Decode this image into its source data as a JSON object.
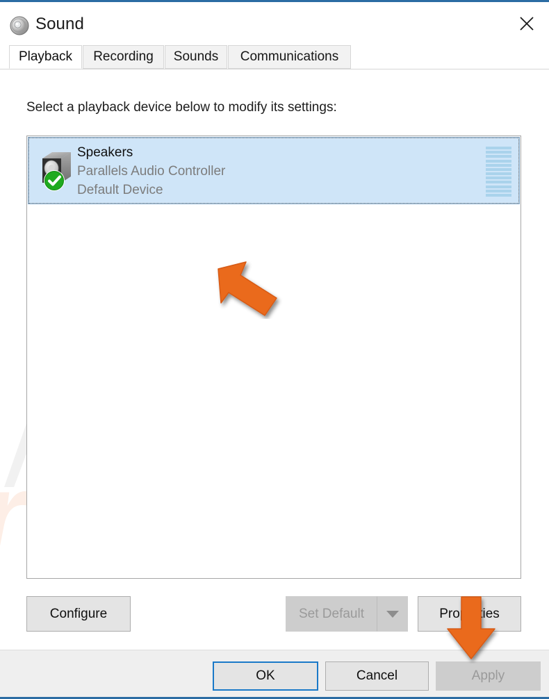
{
  "window": {
    "title": "Sound",
    "icon": "speaker-icon",
    "close_label": "✕",
    "accent_border": "#2b6ca3"
  },
  "tabs": [
    {
      "label": "Playback",
      "active": true
    },
    {
      "label": "Recording",
      "active": false
    },
    {
      "label": "Sounds",
      "active": false
    },
    {
      "label": "Communications",
      "active": false
    }
  ],
  "content": {
    "instruction": "Select a playback device below to modify its settings:"
  },
  "devices": [
    {
      "name": "Speakers",
      "description": "Parallels Audio Controller",
      "status": "Default Device",
      "selected": true,
      "default_badge": "check-circle-icon",
      "meter_segments": 12,
      "meter_active": 0
    }
  ],
  "middle_buttons": [
    {
      "id": "configure",
      "label": "Configure",
      "disabled": false
    },
    {
      "id": "set_default",
      "label": "Set Default",
      "disabled": true,
      "has_dropdown": true
    },
    {
      "id": "properties",
      "label": "Properties",
      "disabled": false
    }
  ],
  "footer_buttons": [
    {
      "id": "ok",
      "label": "OK",
      "disabled": false,
      "focused": true
    },
    {
      "id": "cancel",
      "label": "Cancel",
      "disabled": false,
      "focused": false
    },
    {
      "id": "apply",
      "label": "Apply",
      "disabled": true,
      "focused": false
    }
  ],
  "watermark": {
    "primary_text": "PC",
    "secondary_text": "risk.com",
    "primary_color": "#f0f0f0",
    "secondary_color": "#fdeee6"
  },
  "annotations": [
    {
      "id": "arrow-up",
      "direction": "up-left",
      "color": "#ea6a1c",
      "target": "device-row"
    },
    {
      "id": "arrow-down",
      "direction": "down",
      "color": "#ea6a1c",
      "target": "properties-button"
    }
  ],
  "colors": {
    "selection_blue": "#cfe5f8",
    "meter_bar": "#aad3ec",
    "focus_blue": "#1a79c8",
    "accent_orange": "#ea6a1c",
    "default_green": "#17a317"
  }
}
